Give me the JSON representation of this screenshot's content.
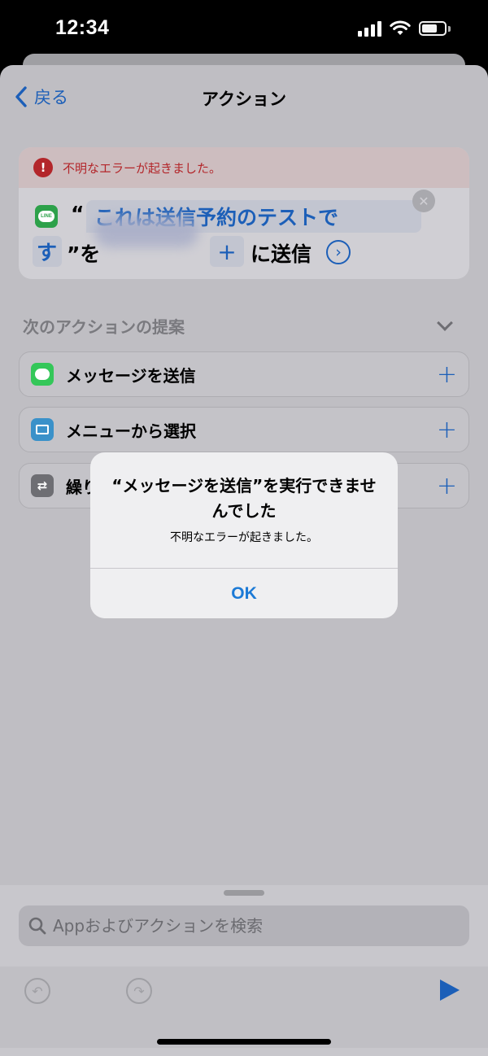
{
  "status_bar": {
    "time": "12:34"
  },
  "nav": {
    "back_label": "戻る",
    "title": "アクション"
  },
  "action_card": {
    "error_text": "不明なエラーが起きました。",
    "app_icon": "line-icon",
    "app_icon_text": "LINE",
    "open_quote": "“",
    "message_line1": "これは送信予約のテストで",
    "message_line2": "す",
    "close_quote_suffix": "”を",
    "plus_label": "+",
    "send_label": "に送信"
  },
  "suggestions": {
    "header": "次のアクションの提案",
    "items": [
      {
        "label": "メッセージを送信",
        "icon": "messages-icon",
        "color": "#34c759"
      },
      {
        "label": "メニューから選択",
        "icon": "menu-icon",
        "color": "#3a91c9"
      },
      {
        "label": "繰り",
        "icon": "repeat-icon",
        "color": "#6e6e73"
      }
    ],
    "add_label": "+"
  },
  "alert": {
    "title": "“メッセージを送信”を実行できませんでした",
    "message": "不明なエラーが起きました。",
    "ok_label": "OK"
  },
  "search": {
    "placeholder": "Appおよびアクションを検索"
  },
  "colors": {
    "accent": "#1c5fb8",
    "error": "#b3262a",
    "alert_button": "#1c7ad6"
  }
}
